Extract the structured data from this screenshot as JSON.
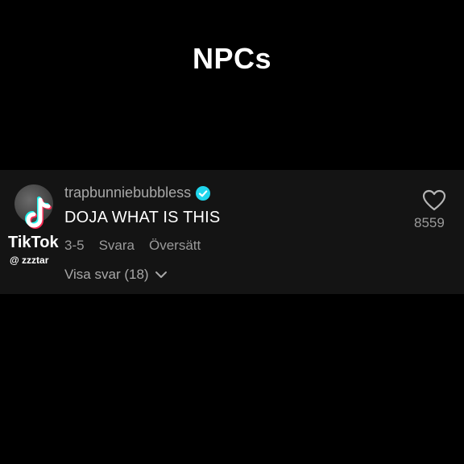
{
  "overlay": {
    "title": "NPCs"
  },
  "comment": {
    "username": "trapbunniebubbless",
    "verified": true,
    "text": "DOJA WHAT IS THIS",
    "date": "3-5",
    "reply_label": "Svara",
    "translate_label": "Översätt",
    "view_replies_label": "Visa svar (18)",
    "like_count": "8559"
  },
  "watermark": {
    "brand": "TikTok",
    "handle": "@ zzztar"
  },
  "icons": {
    "like": "heart-icon",
    "verified": "verified-check-icon",
    "expand": "chevron-down-icon",
    "brand": "tiktok-logo-icon"
  },
  "colors": {
    "background": "#000000",
    "card": "#141414",
    "verified": "#20d5ec",
    "muted_text": "#a8a8a8"
  }
}
